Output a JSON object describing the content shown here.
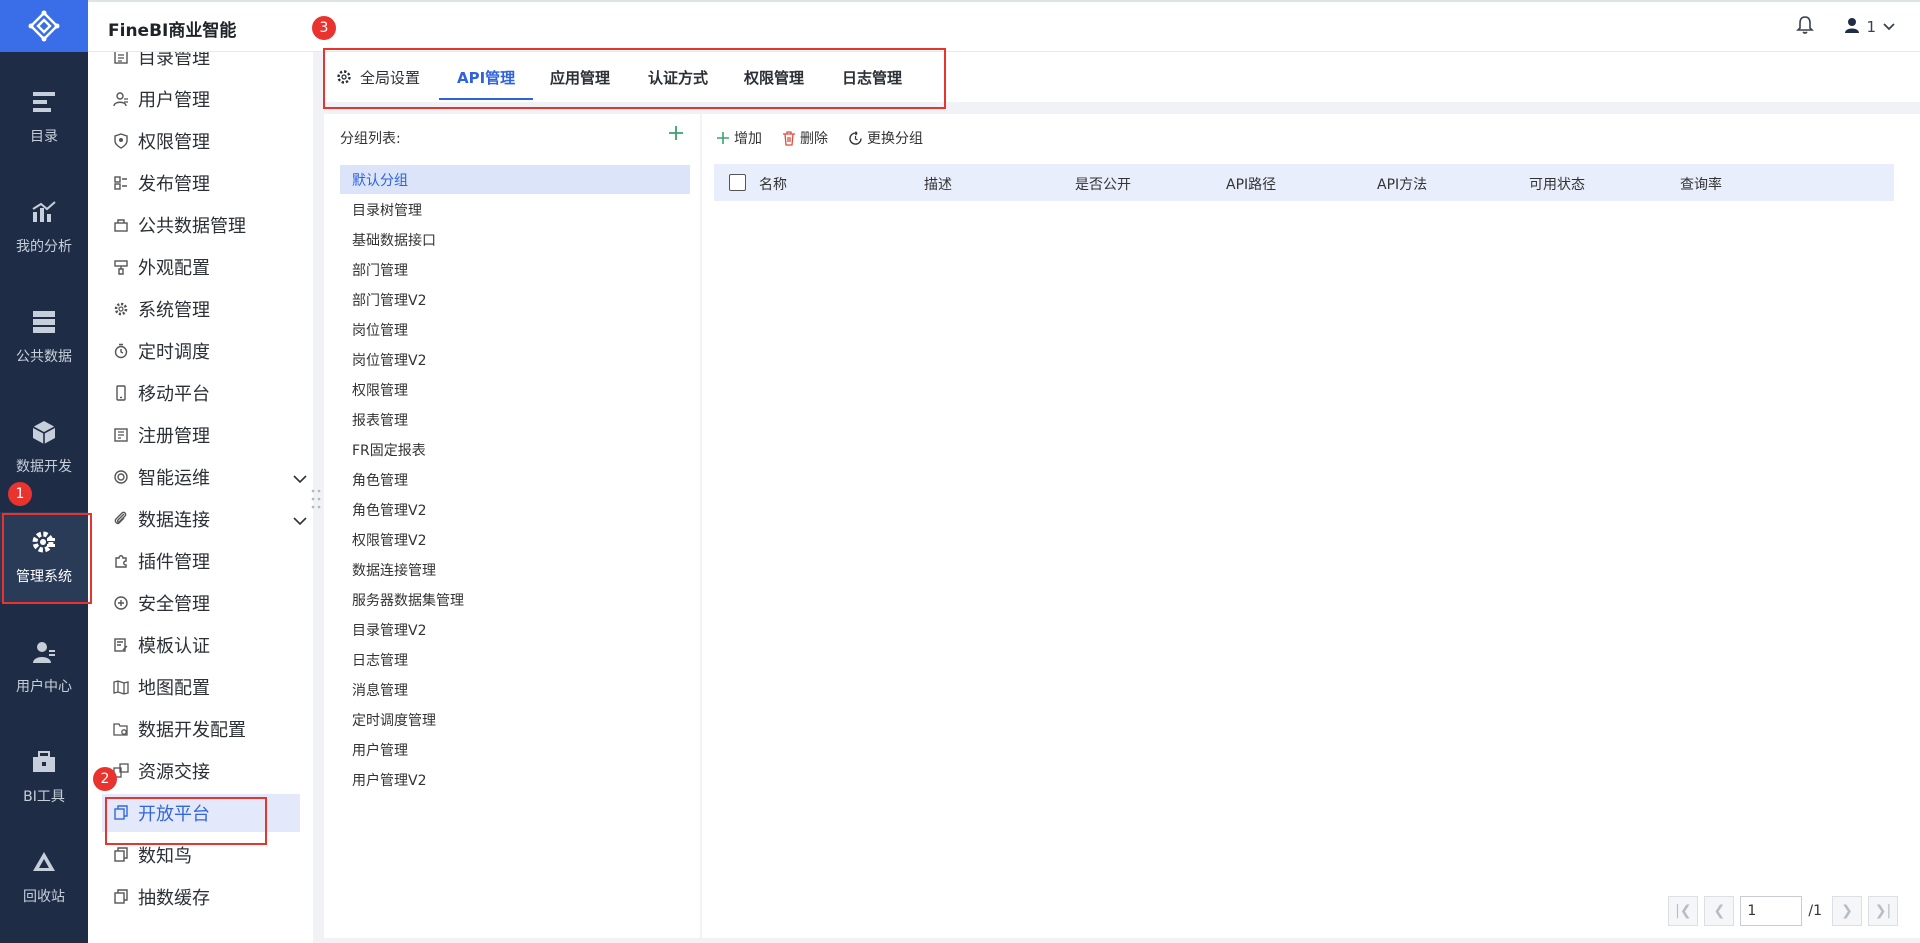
{
  "app": {
    "title": "FineBI商业智能"
  },
  "header": {
    "user_name": "1"
  },
  "rail": {
    "items": [
      {
        "label": "目录",
        "icon": "catalog-icon"
      },
      {
        "label": "我的分析",
        "icon": "analysis-icon"
      },
      {
        "label": "公共数据",
        "icon": "public-data-icon"
      },
      {
        "label": "数据开发",
        "icon": "data-dev-icon"
      },
      {
        "label": "管理系统",
        "icon": "admin-system-icon"
      },
      {
        "label": "用户中心",
        "icon": "user-center-icon"
      },
      {
        "label": "BI工具",
        "icon": "toolbox-icon"
      },
      {
        "label": "回收站",
        "icon": "recycle-bin-icon"
      }
    ],
    "active_index": 4
  },
  "subnav": {
    "items": [
      {
        "label": "目录管理",
        "icon": "catalog-manage-icon"
      },
      {
        "label": "用户管理",
        "icon": "user-manage-icon"
      },
      {
        "label": "权限管理",
        "icon": "permission-icon"
      },
      {
        "label": "发布管理",
        "icon": "publish-icon"
      },
      {
        "label": "公共数据管理",
        "icon": "public-data-manage-icon"
      },
      {
        "label": "外观配置",
        "icon": "appearance-icon"
      },
      {
        "label": "系统管理",
        "icon": "system-gear-icon"
      },
      {
        "label": "定时调度",
        "icon": "timer-icon"
      },
      {
        "label": "移动平台",
        "icon": "mobile-icon"
      },
      {
        "label": "注册管理",
        "icon": "register-icon"
      },
      {
        "label": "智能运维",
        "icon": "ops-icon",
        "expandable": true
      },
      {
        "label": "数据连接",
        "icon": "link-icon",
        "expandable": true
      },
      {
        "label": "插件管理",
        "icon": "plugin-icon"
      },
      {
        "label": "安全管理",
        "icon": "security-icon"
      },
      {
        "label": "模板认证",
        "icon": "template-cert-icon"
      },
      {
        "label": "地图配置",
        "icon": "map-icon"
      },
      {
        "label": "数据开发配置",
        "icon": "data-dev-config-icon"
      },
      {
        "label": "资源交接",
        "icon": "resource-handover-icon"
      },
      {
        "label": "开放平台",
        "icon": "open-platform-icon",
        "active": true
      },
      {
        "label": "数知鸟",
        "icon": "shuzhiniao-icon"
      },
      {
        "label": "抽数缓存",
        "icon": "extract-cache-icon"
      }
    ]
  },
  "tabs": [
    {
      "label": "全局设置",
      "icon": "gear-icon"
    },
    {
      "label": "API管理",
      "active": true
    },
    {
      "label": "应用管理"
    },
    {
      "label": "认证方式"
    },
    {
      "label": "权限管理"
    },
    {
      "label": "日志管理"
    }
  ],
  "groups": {
    "header": "分组列表:",
    "items": [
      "默认分组",
      "目录树管理",
      "基础数据接口",
      "部门管理",
      "部门管理V2",
      "岗位管理",
      "岗位管理V2",
      "权限管理",
      "报表管理",
      "FR固定报表",
      "角色管理",
      "角色管理V2",
      "权限管理V2",
      "数据连接管理",
      "服务器数据集管理",
      "目录管理V2",
      "日志管理",
      "消息管理",
      "定时调度管理",
      "用户管理",
      "用户管理V2"
    ],
    "selected_index": 0
  },
  "toolbar": {
    "add_label": "增加",
    "delete_label": "删除",
    "change_group_label": "更换分组"
  },
  "table": {
    "columns": [
      "名称",
      "描述",
      "是否公开",
      "API路径",
      "API方法",
      "可用状态",
      "查询率"
    ]
  },
  "pager": {
    "current_page": "1",
    "total": "/1"
  },
  "annotations": {
    "badge1": "1",
    "badge2": "2",
    "badge3": "3"
  },
  "colors": {
    "accent": "#2f62e0",
    "rail_bg": "#1e2d45",
    "annotation_red": "#e8332f",
    "add_green": "#3aa36d",
    "delete_red": "#e04b3c"
  }
}
